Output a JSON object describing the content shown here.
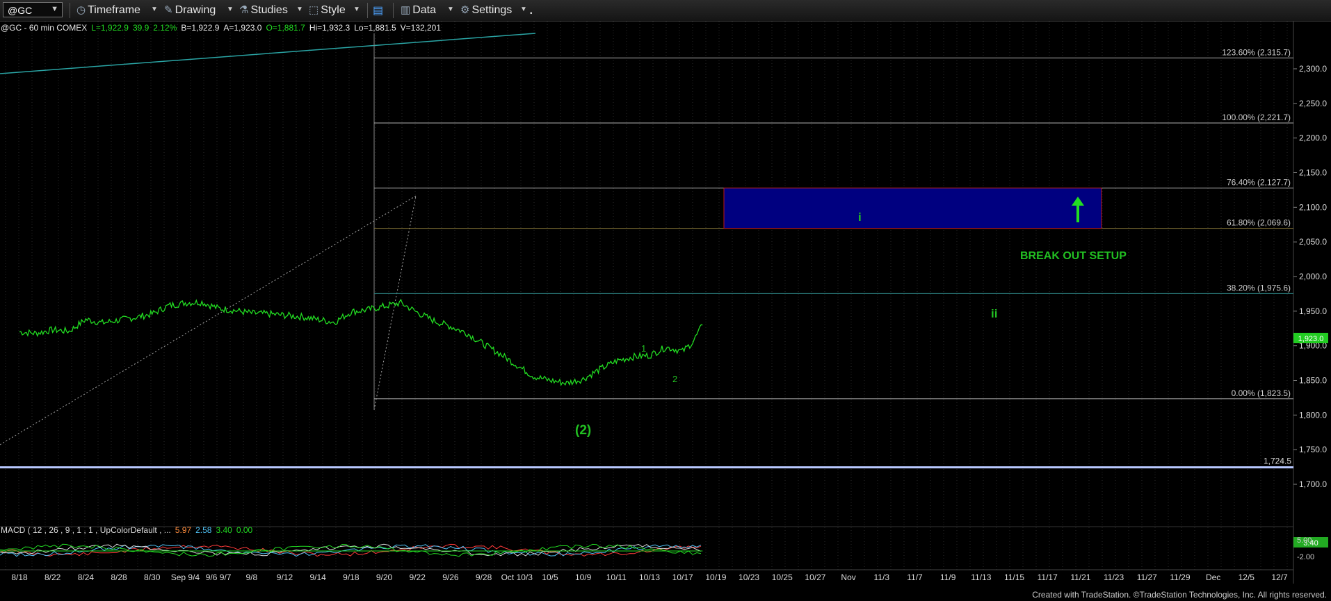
{
  "toolbar": {
    "symbol": "@GC",
    "timeframe": "Timeframe",
    "drawing": "Drawing",
    "studies": "Studies",
    "style": "Style",
    "data": "Data",
    "settings": "Settings"
  },
  "header": {
    "symbol_line": "@GC - 60 min  COMEX",
    "last_label": "L=",
    "last": "1,922.9",
    "change": "39.9",
    "change_pct": "2.12%",
    "bid": "B=1,922.9",
    "ask": "A=1,923.0",
    "open": "O=1,881.7",
    "high": "Hi=1,932.3",
    "low": "Lo=1,881.5",
    "volume": "V=132,201"
  },
  "colors": {
    "background": "#000000",
    "price_line": "#22dd22",
    "fib_line": "#b0b0b0",
    "target_box": "#000080",
    "target_border": "#c01818",
    "label_green": "#22c022",
    "trendline": "#2aa5a5",
    "support_line": "#b8c8ff"
  },
  "chart_data": {
    "type": "line",
    "title": "@GC - 60 min",
    "x_tick_labels": [
      "8/18",
      "8/22",
      "8/24",
      "8/28",
      "8/30",
      "Sep 9/4",
      "9/6 9/7",
      "9/8",
      "9/12",
      "9/14",
      "9/18",
      "9/20",
      "9/22",
      "9/26",
      "9/28",
      "Oct 10/3",
      "10/5",
      "10/9",
      "10/11",
      "10/13",
      "10/17",
      "10/19",
      "10/23",
      "10/25",
      "10/27",
      "Nov",
      "11/3",
      "11/7",
      "11/9",
      "11/13",
      "11/15",
      "11/17",
      "11/21",
      "11/23",
      "11/27",
      "11/29",
      "Dec",
      "12/5",
      "12/7"
    ],
    "y_tick_labels": [
      "2,300.0",
      "2,250.0",
      "2,200.0",
      "2,150.0",
      "2,100.0",
      "2,050.0",
      "2,000.0",
      "1,950.0",
      "1,900.0",
      "1,850.0",
      "1,800.0",
      "1,750.0",
      "1,700.0"
    ],
    "ylim": [
      1680,
      2340
    ],
    "last_price_label": "1,923.0",
    "series": [
      {
        "values": [
          [
            0,
            1920
          ],
          [
            0.5,
            1918
          ],
          [
            1,
            1923
          ],
          [
            1.5,
            1921
          ],
          [
            2,
            1938
          ],
          [
            2.5,
            1933
          ],
          [
            3,
            1937
          ],
          [
            3.5,
            1941
          ],
          [
            4,
            1946
          ],
          [
            4.5,
            1958
          ],
          [
            5,
            1962
          ],
          [
            5.5,
            1963
          ],
          [
            6,
            1954
          ],
          [
            6.5,
            1951
          ],
          [
            7,
            1947
          ],
          [
            7.5,
            1946
          ],
          [
            8,
            1944
          ],
          [
            8.5,
            1942
          ],
          [
            9,
            1938
          ],
          [
            9.5,
            1934
          ],
          [
            10,
            1949
          ],
          [
            10.5,
            1952
          ],
          [
            11,
            1957
          ],
          [
            11.5,
            1962
          ],
          [
            12,
            1948
          ],
          [
            12.5,
            1936
          ],
          [
            13,
            1928
          ],
          [
            13.5,
            1918
          ],
          [
            14,
            1902
          ],
          [
            14.5,
            1888
          ],
          [
            15,
            1872
          ],
          [
            15.5,
            1856
          ],
          [
            16,
            1850
          ],
          [
            16.5,
            1846
          ],
          [
            17,
            1852
          ],
          [
            17.5,
            1866
          ],
          [
            18,
            1878
          ],
          [
            18.5,
            1884
          ],
          [
            19,
            1886
          ],
          [
            19.5,
            1898
          ],
          [
            20,
            1892
          ],
          [
            20.3,
            1905
          ],
          [
            20.6,
            1930
          ]
        ]
      }
    ],
    "fib_levels": [
      {
        "label": "123.60% (2,315.7)",
        "value": 2315.7
      },
      {
        "label": "100.00% (2,221.7)",
        "value": 2221.7
      },
      {
        "label": "76.40% (2,127.7)",
        "value": 2127.7
      },
      {
        "label": "61.80% (2,069.6)",
        "value": 2069.6
      },
      {
        "label": "38.20% (1,975.6)",
        "value": 1975.6
      },
      {
        "label": "0.00% (1,823.5)",
        "value": 1823.5
      }
    ],
    "support_level": {
      "label": "1,724.5",
      "value": 1724.5
    },
    "target_zone": {
      "low": 2069.6,
      "high": 2127.7
    },
    "annotations": {
      "wave_i": "i",
      "wave_ii": "ii",
      "wave_2_circled": "(2)",
      "wave_1": "1",
      "wave_2": "2",
      "setup": "BREAK OUT SETUP"
    },
    "macd": {
      "label": "MACD ( 12 , 26 , 9 , 1 , 1 , UpColorDefault , ...",
      "values": [
        "5.97",
        "2.58",
        "3.40",
        "0.00"
      ],
      "axis_labels": [
        "5.00",
        "-2.00"
      ],
      "current_label": "3.40"
    }
  },
  "footer": "Created with TradeStation. ©TradeStation Technologies, Inc. All rights reserved."
}
